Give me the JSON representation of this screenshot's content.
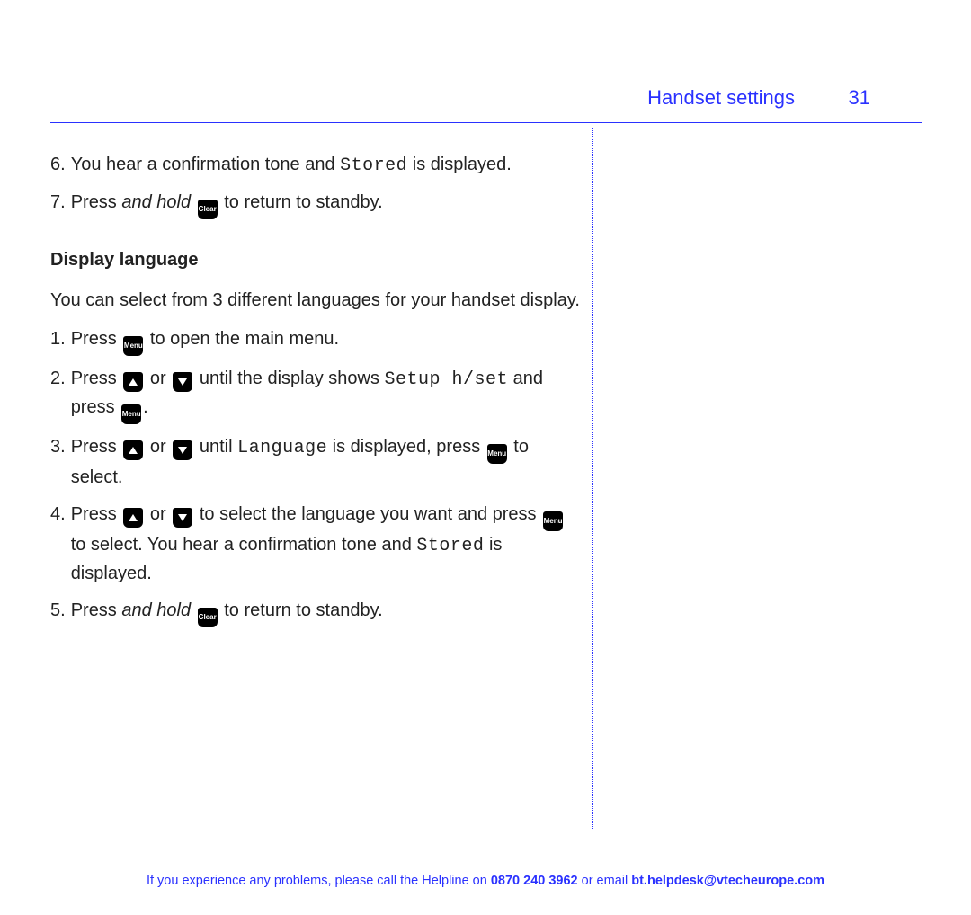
{
  "header": {
    "title": "Handset settings",
    "page_number": "31"
  },
  "keys": {
    "clear": "Clear",
    "menu": "Menu"
  },
  "t": {
    "s6a": "You hear a confirmation tone and ",
    "s6_stored": "Stored",
    "s6c": " is displayed.",
    "s7a": "Press ",
    "s7b": "and hold",
    "s7c": " to return to standby.",
    "dl_h": "Display language",
    "dl_intro": "You can select from 3 different languages for your handset display.",
    "dl1a": "Press ",
    "dl1b": " to open the main menu.",
    "dl2a": "Press ",
    "dl2_or": " or ",
    "dl2b": " until the display shows ",
    "dl2_setup": "Setup h/set",
    "dl2c": " and press ",
    "dl2d": ".",
    "dl3a": "Press ",
    "dl3b": " until ",
    "dl3_lang": "Language",
    "dl3c": " is displayed, press ",
    "dl3d": " to select.",
    "dl4a": "Press ",
    "dl4b": " to select the language you want and press ",
    "dl4c": " to select. You hear a confirmation tone and ",
    "dl4_stored": "Stored",
    "dl4d": " is displayed.",
    "dl5a": "Press ",
    "dl5b": "and hold",
    "dl5c": " to return to standby."
  },
  "nums": {
    "n6": "6.",
    "n7": "7.",
    "n1": "1.",
    "n2": "2.",
    "n3": "3.",
    "n4": "4.",
    "n5": "5."
  },
  "footer": {
    "a": "If you experience any problems, please call the Helpline on ",
    "phone": "0870 240 3962",
    "b": " or email ",
    "email": "bt.helpdesk@vtecheurope.com"
  }
}
